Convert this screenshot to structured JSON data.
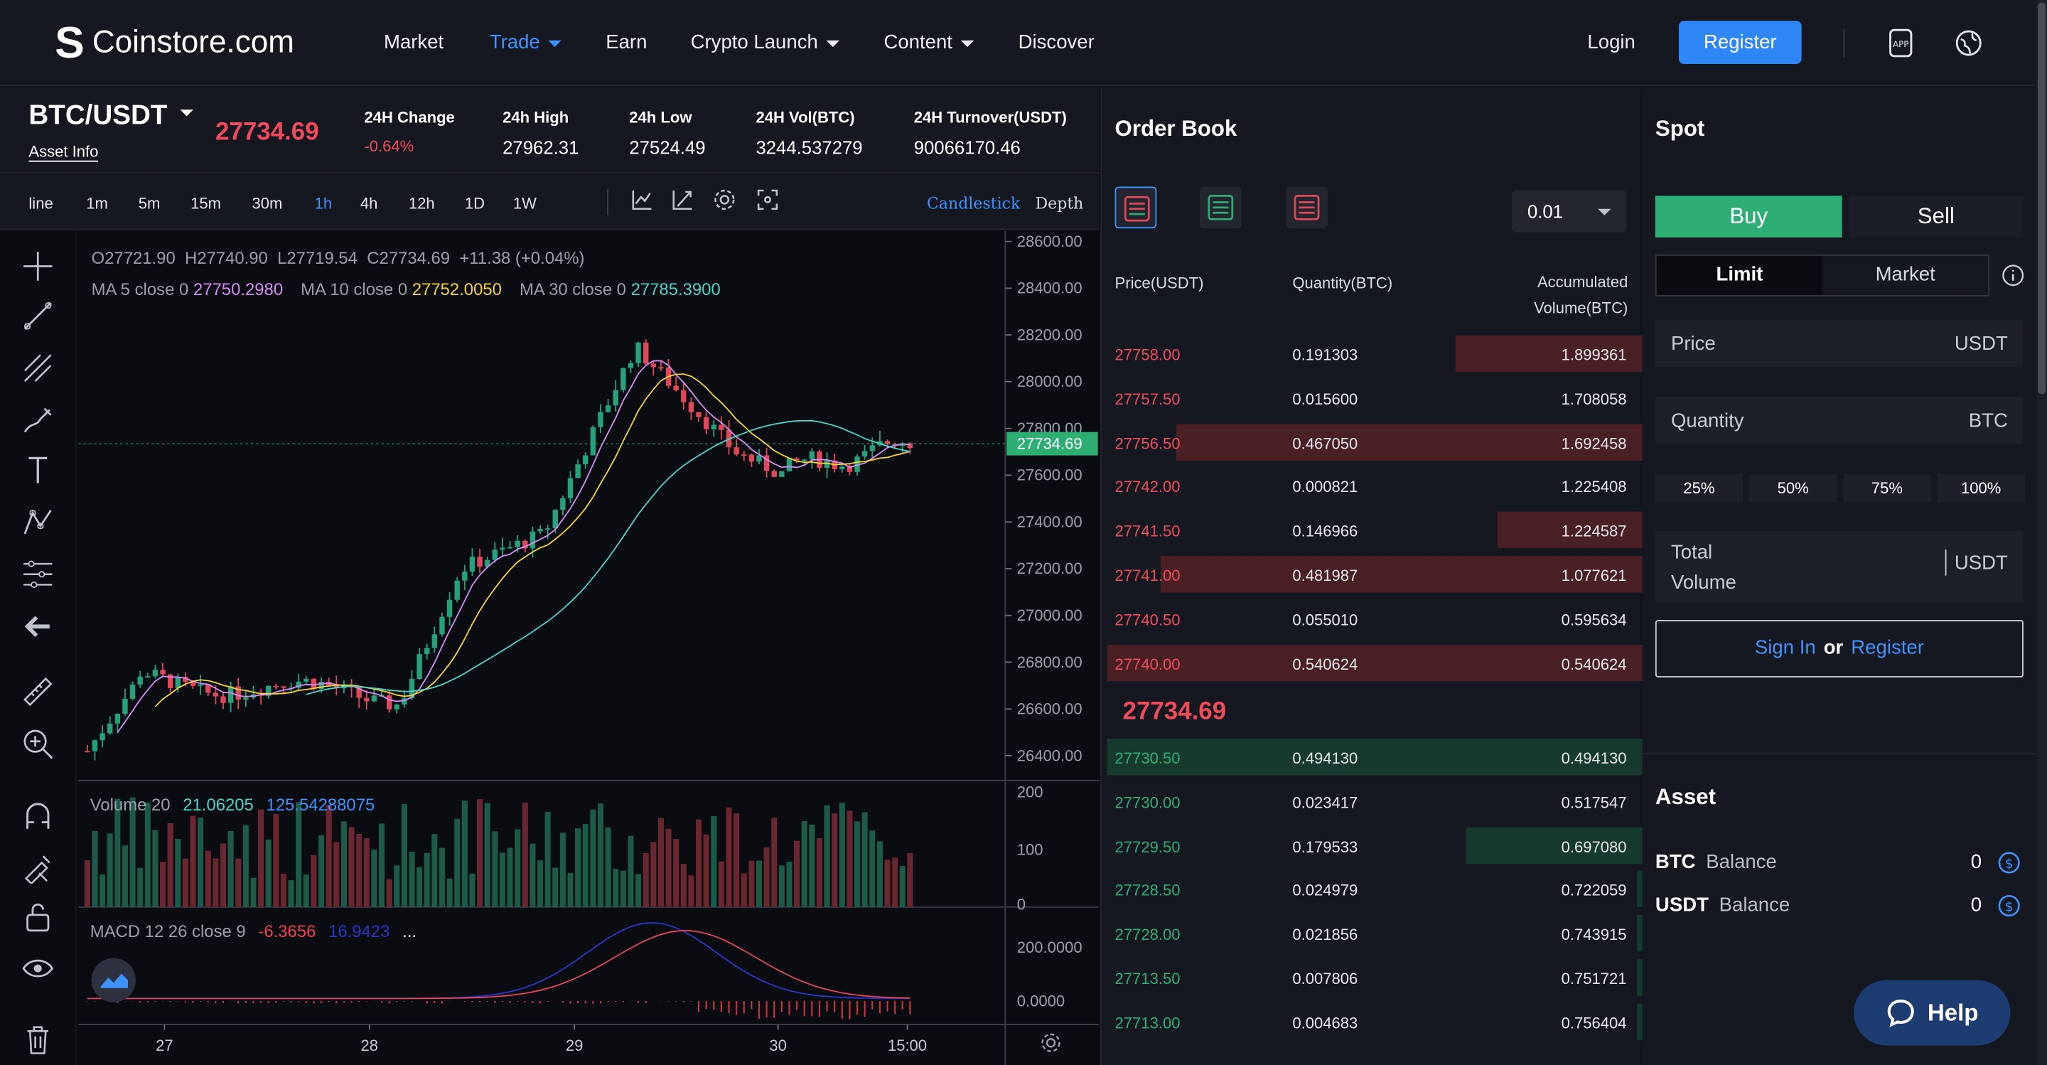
{
  "nav": {
    "logo": "Coinstore.com",
    "items": [
      {
        "label": "Market",
        "active": false,
        "dropdown": false
      },
      {
        "label": "Trade",
        "active": true,
        "dropdown": true
      },
      {
        "label": "Earn",
        "active": false,
        "dropdown": false
      },
      {
        "label": "Crypto Launch",
        "active": false,
        "dropdown": true
      },
      {
        "label": "Content",
        "active": false,
        "dropdown": true
      },
      {
        "label": "Discover",
        "active": false,
        "dropdown": false
      }
    ],
    "login": "Login",
    "register": "Register",
    "icons": [
      "app-download-icon",
      "language-globe-icon"
    ]
  },
  "ticker": {
    "pair": "BTC/USDT",
    "asset_info": "Asset Info",
    "last_price": "27734.69",
    "stats": [
      {
        "label": "24H Change",
        "value": "-0.64%",
        "negative": true
      },
      {
        "label": "24h High",
        "value": "27962.31"
      },
      {
        "label": "24h Low",
        "value": "27524.49"
      },
      {
        "label": "24H Vol(BTC)",
        "value": "3244.537279"
      },
      {
        "label": "24H Turnover(USDT)",
        "value": "90066170.46"
      }
    ]
  },
  "timebar": {
    "intervals": [
      "line",
      "1m",
      "5m",
      "15m",
      "30m",
      "1h",
      "4h",
      "12h",
      "1D",
      "1W"
    ],
    "active_interval": "1h",
    "tool_icons": [
      "indicator-icon",
      "drawing-icon",
      "settings-gear-icon",
      "fullscreen-icon"
    ],
    "views": [
      "Candlestick",
      "Depth"
    ],
    "active_view": "Candlestick"
  },
  "chart": {
    "ohlc_line": "O27721.90  H27740.90  L27719.54  C27734.69  +11.38 (+0.04%)",
    "ma": [
      {
        "label": "MA 5 close 0",
        "value": "27750.2980",
        "color": "#d58cf2"
      },
      {
        "label": "MA 10 close 0",
        "value": "27752.0050",
        "color": "#f5d33b"
      },
      {
        "label": "MA 30 close 0",
        "value": "27785.3900",
        "color": "#4fd3c6"
      }
    ],
    "price_axis": [
      "28600.00",
      "28400.00",
      "28200.00",
      "28000.00",
      "27800.00",
      "27600.00",
      "27400.00",
      "27200.00",
      "27000.00",
      "26800.00",
      "26600.00",
      "26400.00"
    ],
    "current_price_tag": "27734.69",
    "volume": {
      "label": "Volume 20",
      "v1": "21.06205",
      "v2": "125.54288075",
      "axis": [
        "200",
        "100",
        "0"
      ]
    },
    "macd": {
      "label": "MACD 12 26 close 9",
      "v1": "-6.3656",
      "v2": "16.9423",
      "more": "...",
      "axis": [
        "200.0000",
        "0.0000"
      ]
    },
    "time_axis": [
      "27",
      "28",
      "29",
      "30",
      "15:00"
    ],
    "colors": {
      "up": "#26a17b",
      "down": "#e0485a",
      "grid": "#1f2129"
    }
  },
  "left_tools": [
    "crosshair-icon",
    "trend-line-icon",
    "fib-icon",
    "brush-icon",
    "text-icon",
    "pattern-icon",
    "projection-icon",
    "back-arrow-icon",
    "ruler-icon",
    "zoom-in-icon",
    "magnet-icon",
    "lock-drawing-icon",
    "unlock-icon",
    "eye-icon",
    "trash-icon"
  ],
  "orderbook": {
    "title": "Order Book",
    "depth": "0.01",
    "headers": {
      "price": "Price(USDT)",
      "qty": "Quantity(BTC)",
      "acc1": "Accumulated",
      "acc2": "Volume(BTC)"
    },
    "asks": [
      {
        "price": "27758.00",
        "qty": "0.191303",
        "acc": "1.899361",
        "depth": 0.35
      },
      {
        "price": "27757.50",
        "qty": "0.015600",
        "acc": "1.708058",
        "depth": 0.0
      },
      {
        "price": "27756.50",
        "qty": "0.467050",
        "acc": "1.692458",
        "depth": 0.87
      },
      {
        "price": "27742.00",
        "qty": "0.000821",
        "acc": "1.225408",
        "depth": 0.0
      },
      {
        "price": "27741.50",
        "qty": "0.146966",
        "acc": "1.224587",
        "depth": 0.27
      },
      {
        "price": "27741.00",
        "qty": "0.481987",
        "acc": "1.077621",
        "depth": 0.9
      },
      {
        "price": "27740.50",
        "qty": "0.055010",
        "acc": "0.595634",
        "depth": 0.0
      },
      {
        "price": "27740.00",
        "qty": "0.540624",
        "acc": "0.540624",
        "depth": 1.0
      }
    ],
    "mid_price": "27734.69",
    "bids": [
      {
        "price": "27730.50",
        "qty": "0.494130",
        "acc": "0.494130",
        "depth": 1.0
      },
      {
        "price": "27730.00",
        "qty": "0.023417",
        "acc": "0.517547",
        "depth": 0.0
      },
      {
        "price": "27729.50",
        "qty": "0.179533",
        "acc": "0.697080",
        "depth": 0.33
      },
      {
        "price": "27728.50",
        "qty": "0.024979",
        "acc": "0.722059",
        "depth": 0.01
      },
      {
        "price": "27728.00",
        "qty": "0.021856",
        "acc": "0.743915",
        "depth": 0.01
      },
      {
        "price": "27713.50",
        "qty": "0.007806",
        "acc": "0.751721",
        "depth": 0.01
      },
      {
        "price": "27713.00",
        "qty": "0.004683",
        "acc": "0.756404",
        "depth": 0.01
      }
    ],
    "colors": {
      "ask": "#f04a5b",
      "bid": "#2ead74",
      "ask_bg": "#4a2025",
      "bid_bg": "#173a2f"
    }
  },
  "spot": {
    "title": "Spot",
    "buy": "Buy",
    "sell": "Sell",
    "limit": "Limit",
    "market": "Market",
    "price_label": "Price",
    "price_unit": "USDT",
    "qty_label": "Quantity",
    "qty_unit": "BTC",
    "percents": [
      "25%",
      "50%",
      "75%",
      "100%"
    ],
    "total_label_1": "Total",
    "total_label_2": "Volume",
    "total_unit": "USDT",
    "sign_in": "Sign In",
    "or": "or",
    "register": "Register",
    "asset_title": "Asset",
    "balances": [
      {
        "coin": "BTC",
        "label": "Balance",
        "value": "0"
      },
      {
        "coin": "USDT",
        "label": "Balance",
        "value": "0"
      }
    ]
  },
  "help": "Help"
}
